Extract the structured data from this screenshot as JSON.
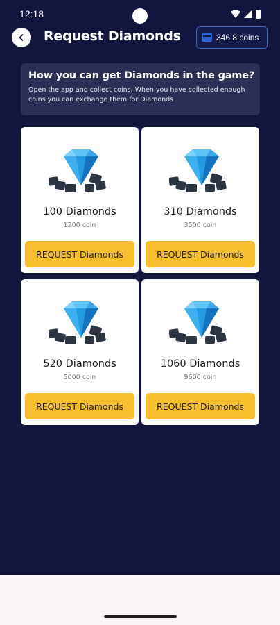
{
  "status_bar": {
    "time": "12:18"
  },
  "header": {
    "title": "Request Diamonds",
    "coins": "346.8 coins",
    "back_icon": "chevron-left-icon",
    "wallet_icon": "wallet-icon"
  },
  "info": {
    "title": "How you can get Diamonds in the game?",
    "text": "Open the app and collect coins. When you have collected enough coins you can exchange them for Diamonds"
  },
  "products": [
    {
      "name": "100 Diamonds",
      "price": "1200 coin",
      "button": "REQUEST Diamonds"
    },
    {
      "name": "310 Diamonds",
      "price": "3500 coin",
      "button": "REQUEST Diamonds"
    },
    {
      "name": "520 Diamonds",
      "price": "5000 coin",
      "button": "REQUEST Diamonds"
    },
    {
      "name": "1060 Diamonds",
      "price": "9600 coin",
      "button": "REQUEST Diamonds"
    }
  ],
  "colors": {
    "background": "#12163f",
    "card": "#ffffff",
    "info_card": "#2b2f56",
    "button": "#f8be2c",
    "badge_border": "#3d67c9",
    "diamond": "#2a9be0"
  }
}
